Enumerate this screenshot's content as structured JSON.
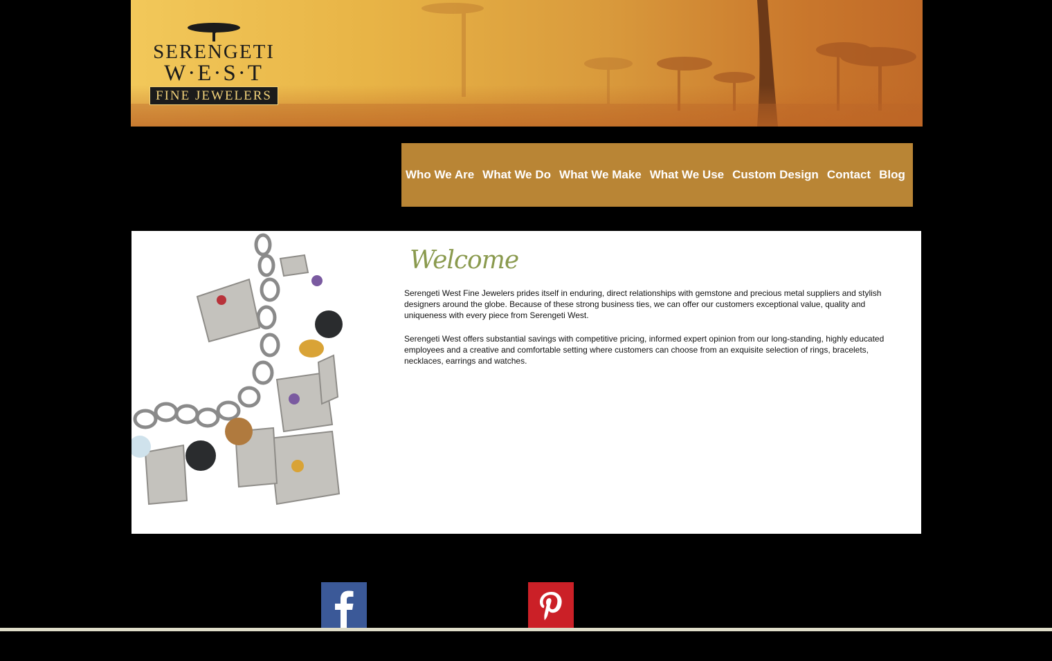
{
  "logo": {
    "line1": "SERENGETI",
    "line2": "W·E·S·T",
    "line3": "FINE JEWELERS"
  },
  "nav": {
    "items": [
      {
        "label": "Who We Are"
      },
      {
        "label": "What We Do"
      },
      {
        "label": "What We Make"
      },
      {
        "label": "What We Use"
      },
      {
        "label": "Custom Design"
      },
      {
        "label": "Contact"
      },
      {
        "label": "Blog"
      }
    ]
  },
  "main": {
    "heading": "Welcome",
    "paragraphs": [
      "Serengeti West Fine Jewelers prides itself in enduring, direct relationships with gemstone and precious metal suppliers and stylish designers around the globe. Because of these strong business ties, we can offer our customers exceptional value, quality and uniqueness with every piece from Serengeti West.",
      "Serengeti West offers substantial savings with competitive pricing, informed expert opinion from our long-standing, highly educated employees and a creative and comfortable setting where customers can choose from an exquisite selection of rings, bracelets, necklaces, earrings and watches."
    ]
  },
  "social": {
    "facebook_icon": "facebook-icon",
    "pinterest_icon": "pinterest-icon"
  },
  "colors": {
    "nav_bg": "#b98535",
    "heading": "#8a9a4e",
    "facebook": "#3b5998",
    "pinterest": "#cb2027"
  }
}
